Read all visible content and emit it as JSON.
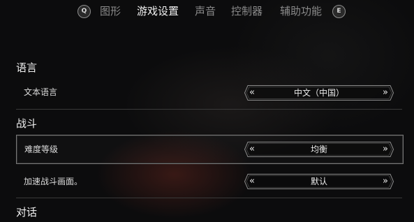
{
  "topbar": {
    "left_key": "Q",
    "right_key": "E",
    "tabs": [
      {
        "label": "图形",
        "active": false
      },
      {
        "label": "游戏设置",
        "active": true
      },
      {
        "label": "声音",
        "active": false
      },
      {
        "label": "控制器",
        "active": false
      },
      {
        "label": "辅助功能",
        "active": false
      }
    ]
  },
  "sections": {
    "language": {
      "title": "语言",
      "text_language": {
        "label": "文本语言",
        "value": "中文（中国）"
      }
    },
    "combat": {
      "title": "战斗",
      "difficulty": {
        "label": "难度等级",
        "value": "均衡"
      },
      "speed_up": {
        "label": "加速战斗画面。",
        "value": "默认"
      }
    },
    "dialogue": {
      "title": "对话"
    }
  },
  "icons": {
    "prev": "«",
    "next": "»"
  }
}
